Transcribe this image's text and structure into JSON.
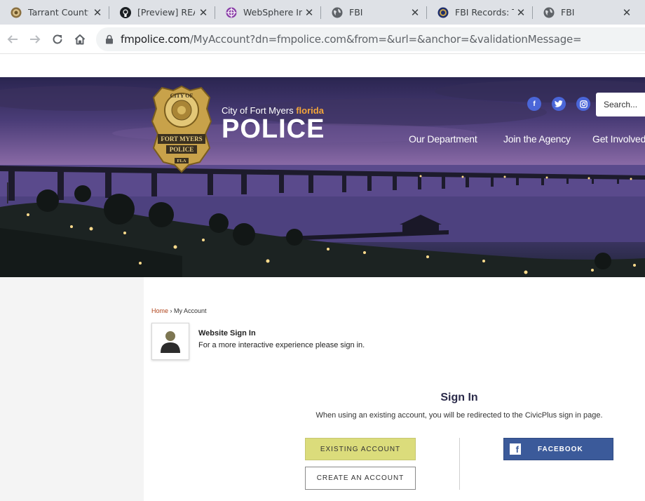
{
  "browser": {
    "tabs": [
      {
        "title": "Tarrant County",
        "icon": "county-seal-icon"
      },
      {
        "title": "[Preview] README",
        "icon": "github-icon"
      },
      {
        "title": "WebSphere Integrated",
        "icon": "websphere-icon"
      },
      {
        "title": "FBI",
        "icon": "globe-icon"
      },
      {
        "title": "FBI Records: The Vault",
        "icon": "fbi-seal-icon"
      },
      {
        "title": "FBI",
        "icon": "globe-icon"
      }
    ],
    "close_glyph": "✕",
    "url_host": "fmpolice.com",
    "url_path": "/MyAccount?dn=fmpolice.com&from=&url=&anchor=&validationMessage="
  },
  "site": {
    "brand_sub": "City of Fort Myers",
    "brand_sub_accent": "florida",
    "brand_main": "POLICE",
    "badge_text_top": "CITY OF",
    "badge_text_mid": "FORT MYERS",
    "badge_text_bottom": "POLICE",
    "badge_text_state": "FLA",
    "social": [
      "f",
      "t",
      "ig"
    ],
    "search_placeholder": "Search...",
    "nav": [
      "Our Department",
      "Join the Agency",
      "Get Involved"
    ]
  },
  "account": {
    "breadcrumb_home": "Home",
    "breadcrumb_sep": " › ",
    "breadcrumb_current": "My Account",
    "signin_title": "Website Sign In",
    "signin_desc": "For a more interactive experience please sign in.",
    "signin_heading": "Sign In",
    "signin_note": "When using an existing account, you will be redirected to the CivicPlus sign in page.",
    "existing_label": "EXISTING ACCOUNT",
    "create_label": "CREATE AN ACCOUNT",
    "facebook_label": "FACEBOOK"
  },
  "colors": {
    "accent_florida": "#f3a53a",
    "existing_button": "#dbdc7b",
    "facebook_button": "#3b5a9a",
    "social_icon": "#4a66d8",
    "breadcrumb_link": "#b0441b"
  }
}
